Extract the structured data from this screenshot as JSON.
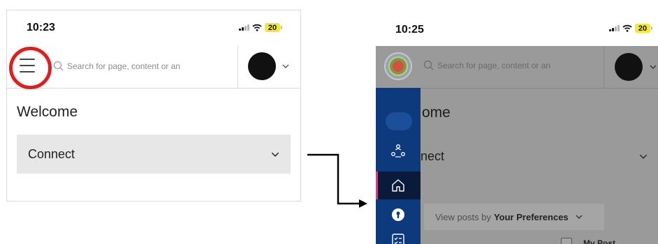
{
  "before": {
    "status": {
      "time": "10:23",
      "battery": "20"
    },
    "search": {
      "placeholder": "Search for page, content or an"
    },
    "welcome": "Welcome",
    "accordion": {
      "label": "Connect"
    }
  },
  "after": {
    "status": {
      "time": "10:25",
      "battery": "20"
    },
    "search": {
      "placeholder": "Search for page, content or an"
    },
    "welcome_partial": "ome",
    "accordion_partial": "nect",
    "view_posts": {
      "prefix": "View posts by",
      "value": "Your Preferences"
    },
    "my_posts_label": "My Post"
  },
  "colors": {
    "highlight_circle": "#e31c1c",
    "sidebar_bg": "#0d3a7d",
    "sidebar_active": "#0a1a3a",
    "sidebar_accent": "#c2457f",
    "overlay": "#9a9a9a",
    "battery": "#f3e83a"
  },
  "icons": [
    "hamburger-menu-icon",
    "search-icon",
    "chevron-down-icon",
    "signal-icon",
    "wifi-icon",
    "people-network-icon",
    "home-icon",
    "keyhole-icon",
    "checklist-icon",
    "arrow-icon"
  ]
}
